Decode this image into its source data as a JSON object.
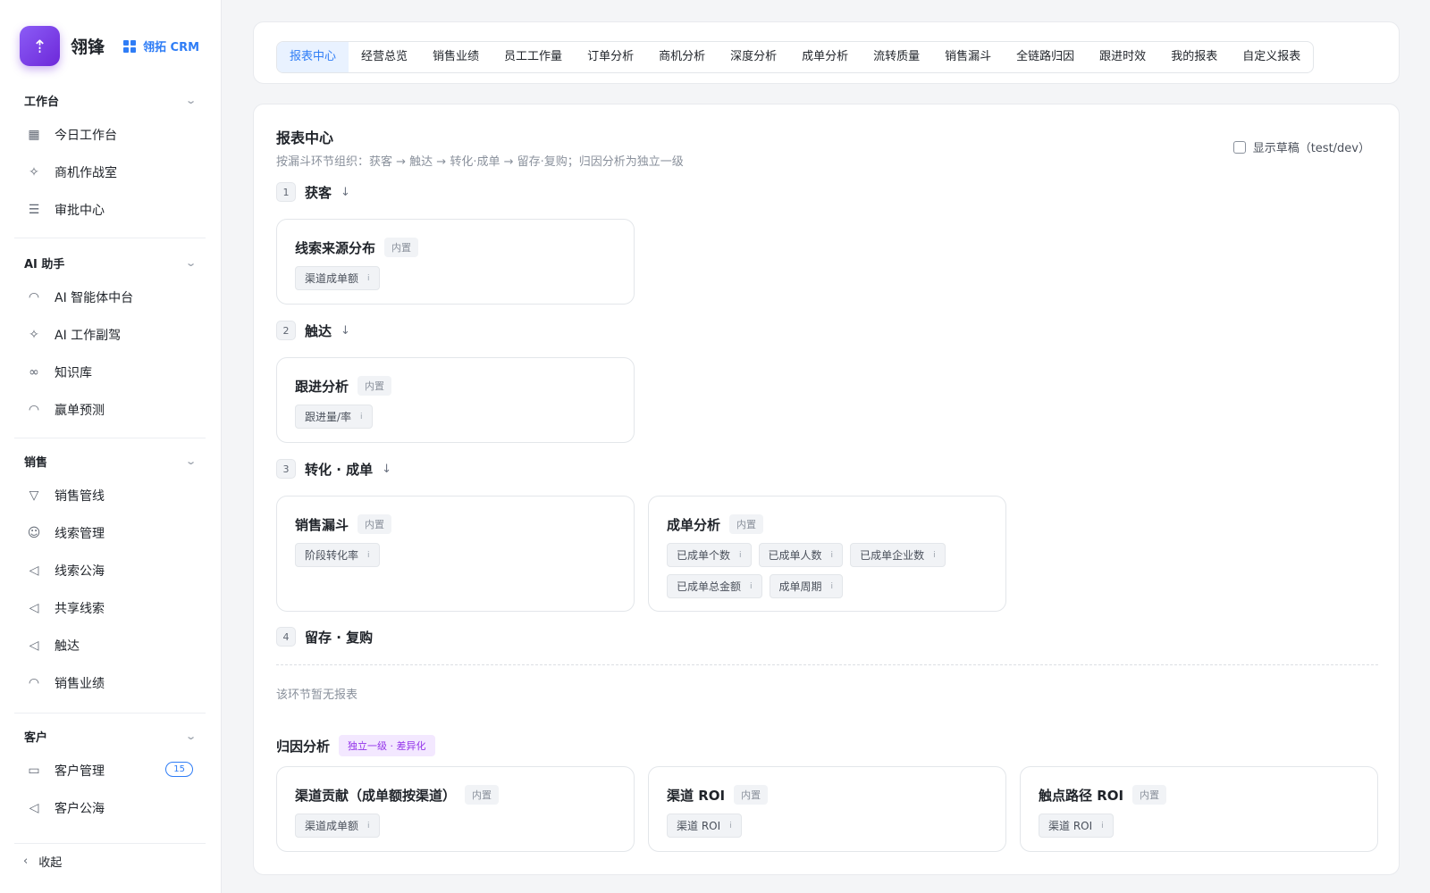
{
  "brand": {
    "name": "翎锋",
    "crm": "翎拓 CRM"
  },
  "sidebar": {
    "groups": [
      {
        "title": "工作台",
        "items": [
          {
            "label": "今日工作台"
          },
          {
            "label": "商机作战室"
          },
          {
            "label": "审批中心"
          }
        ]
      },
      {
        "title": "AI 助手",
        "items": [
          {
            "label": "AI 智能体中台"
          },
          {
            "label": "AI 工作副驾"
          },
          {
            "label": "知识库"
          },
          {
            "label": "赢单预测"
          }
        ]
      },
      {
        "title": "销售",
        "items": [
          {
            "label": "销售管线"
          },
          {
            "label": "线索管理"
          },
          {
            "label": "线索公海"
          },
          {
            "label": "共享线索"
          },
          {
            "label": "触达"
          },
          {
            "label": "销售业绩"
          }
        ]
      },
      {
        "title": "客户",
        "items": [
          {
            "label": "客户管理",
            "badge": "15"
          },
          {
            "label": "客户公海"
          }
        ]
      }
    ],
    "collapse_label": "收起"
  },
  "tabs": [
    {
      "label": "报表中心"
    },
    {
      "label": "经营总览"
    },
    {
      "label": "销售业绩"
    },
    {
      "label": "员工工作量"
    },
    {
      "label": "订单分析"
    },
    {
      "label": "商机分析"
    },
    {
      "label": "深度分析"
    },
    {
      "label": "成单分析"
    },
    {
      "label": "流转质量"
    },
    {
      "label": "销售漏斗"
    },
    {
      "label": "全链路归因"
    },
    {
      "label": "跟进时效"
    },
    {
      "label": "我的报表"
    },
    {
      "label": "自定义报表"
    }
  ],
  "main": {
    "title": "报表中心",
    "subtitle": "按漏斗环节组织：获客 → 触达 → 转化·成单 → 留存·复购；归因分析为独立一级",
    "draft_label": "显示草稿（test/dev）",
    "builtin_label": "内置",
    "stages": [
      {
        "num": "1",
        "name": "获客",
        "arrow": "↓"
      },
      {
        "num": "2",
        "name": "触达",
        "arrow": "↓"
      },
      {
        "num": "3",
        "name": "转化 · 成单",
        "arrow": "↓"
      },
      {
        "num": "4",
        "name": "留存 · 复购"
      }
    ],
    "cards": [
      {
        "title": "线索来源分布",
        "chips": [
          "渠道成单额"
        ]
      },
      {
        "title": "跟进分析",
        "chips": [
          "跟进量/率"
        ]
      },
      {
        "title": "销售漏斗",
        "chips": [
          "阶段转化率"
        ]
      },
      {
        "title": "成单分析",
        "chips": [
          "已成单个数",
          "已成单人数",
          "已成单企业数",
          "已成单总金额",
          "成单周期"
        ]
      }
    ],
    "empty_text": "该环节暂无报表",
    "attribution": {
      "title": "归因分析",
      "tag": "独立一级 · 差异化",
      "cards": [
        {
          "title": "渠道贡献（成单额按渠道）",
          "chips": [
            "渠道成单额"
          ]
        },
        {
          "title": "渠道 ROI",
          "chips": [
            "渠道 ROI"
          ]
        },
        {
          "title": "触点路径 ROI",
          "chips": [
            "渠道 ROI"
          ]
        }
      ]
    }
  }
}
